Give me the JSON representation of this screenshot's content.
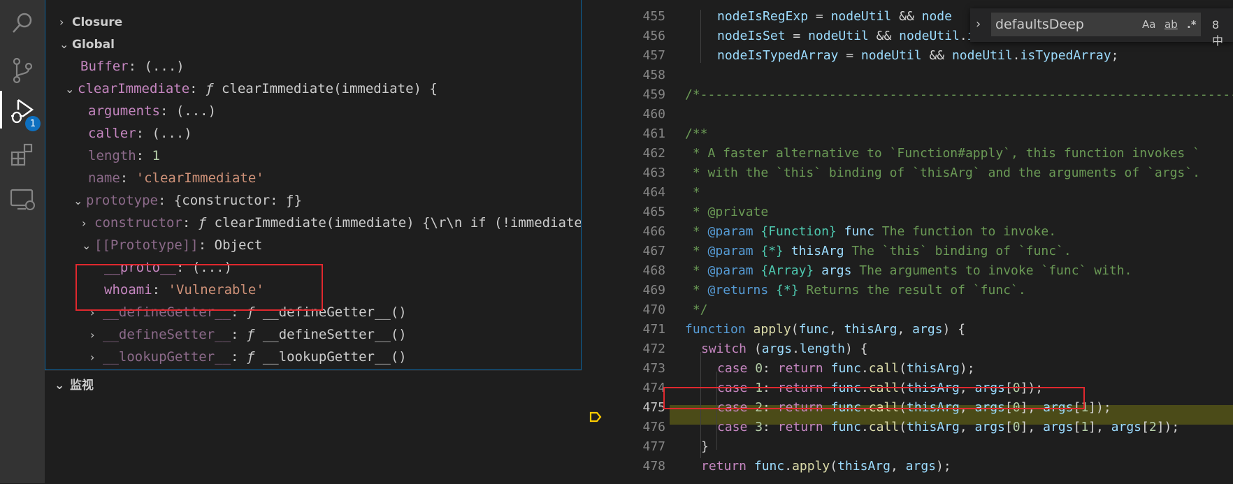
{
  "activity": {
    "items": [
      {
        "name": "search-icon"
      },
      {
        "name": "source-control-icon"
      },
      {
        "name": "run-debug-icon",
        "badge": "1"
      },
      {
        "name": "extensions-icon"
      },
      {
        "name": "remote-explorer-icon"
      }
    ]
  },
  "variables": {
    "scopes": {
      "closure": "Closure",
      "global": "Global"
    },
    "rows": {
      "buffer": {
        "key": "Buffer",
        "sep": ":",
        "val": "(...)"
      },
      "clearImmediate": {
        "key": "clearImmediate",
        "sep": ":",
        "f": "ƒ",
        "val": "clearImmediate(immediate) {"
      },
      "arguments": {
        "key": "arguments",
        "sep": ":",
        "val": "(...)"
      },
      "caller": {
        "key": "caller",
        "sep": ":",
        "val": "(...)"
      },
      "length": {
        "key": "length",
        "sep": ":",
        "val": "1"
      },
      "name": {
        "key": "name",
        "sep": ":",
        "val": "'clearImmediate'"
      },
      "prototype": {
        "key": "prototype",
        "sep": ":",
        "val": "{constructor: ƒ}"
      },
      "constructor": {
        "key": "constructor",
        "sep": ":",
        "f": "ƒ",
        "val": "clearImmediate(immediate) {\\r\\n  if (!immediate…"
      },
      "protoSlot": {
        "key": "[[Prototype]]",
        "sep": ":",
        "val": "Object"
      },
      "proto": {
        "key": "__proto__",
        "sep": ":",
        "val": "(...)"
      },
      "whoami": {
        "key": "whoami",
        "sep": ":",
        "val": "'Vulnerable'"
      },
      "defineGetter": {
        "key": "__defineGetter__",
        "sep": ":",
        "f": "ƒ",
        "val": "__defineGetter__()"
      },
      "defineSetter": {
        "key": "__defineSetter__",
        "sep": ":",
        "f": "ƒ",
        "val": "__defineSetter__()"
      },
      "lookupGetter": {
        "key": "__lookupGetter__",
        "sep": ":",
        "f": "ƒ",
        "val": "__lookupGetter__()"
      }
    }
  },
  "watch": {
    "title": "监视"
  },
  "find": {
    "value": "defaultsDeep",
    "opt_case": "Aa",
    "opt_word": "ab",
    "opt_regex": ".*",
    "count": "8 中"
  },
  "editor": {
    "line_numbers": [
      "455",
      "456",
      "457",
      "458",
      "459",
      "460",
      "461",
      "462",
      "463",
      "464",
      "465",
      "466",
      "467",
      "468",
      "469",
      "470",
      "471",
      "472",
      "473",
      "474",
      "475",
      "476",
      "477",
      "478"
    ],
    "current_line": "475",
    "code": {
      "l455": {
        "a": "nodeIsRegExp",
        "b": " = ",
        "c": "nodeUtil",
        "d": " && ",
        "e": "node"
      },
      "l456": {
        "a": "nodeIsSet",
        "b": " = ",
        "c": "nodeUtil",
        "d": " && ",
        "e": "nodeUtil",
        "f": ".",
        "g": "isSet",
        "h": ";"
      },
      "l457": {
        "a": "nodeIsTypedArray",
        "b": " = ",
        "c": "nodeUtil",
        "d": " && ",
        "e": "nodeUtil",
        "f": ".",
        "g": "isTypedArray",
        "h": ";"
      },
      "l459": "/*------------------------------------------------------------------------",
      "l461": "/**",
      "l462": " * A faster alternative to `Function#apply`, this function invokes `",
      "l463": " * with the `this` binding of `thisArg` and the arguments of `args`.",
      "l464": " *",
      "l465": " * @private",
      "l466": {
        "a": " * ",
        "b": "@param",
        "c": " {Function} ",
        "d": "func",
        "e": " The function to invoke."
      },
      "l467": {
        "a": " * ",
        "b": "@param",
        "c": " {*} ",
        "d": "thisArg",
        "e": " The `this` binding of `func`."
      },
      "l468": {
        "a": " * ",
        "b": "@param",
        "c": " {Array} ",
        "d": "args",
        "e": " The arguments to invoke `func` with."
      },
      "l469": {
        "a": " * ",
        "b": "@returns",
        "c": " {*}",
        "e": " Returns the result of `func`."
      },
      "l470": " */",
      "l471": {
        "kw": "function",
        "fn": "apply",
        "p1": "(",
        "a1": "func",
        "p2": ", ",
        "a2": "thisArg",
        "p3": ", ",
        "a3": "args",
        "p4": ") {"
      },
      "l472": {
        "kw": "switch",
        "p1": " (",
        "a1": "args",
        "p2": ".",
        "a2": "length",
        "p3": ") {"
      },
      "l473": {
        "kw": "case",
        "num": " 0",
        "p1": ": ",
        "kw2": "return",
        "a1": " func",
        "p2": ".",
        "fn": "call",
        "p3": "(",
        "a2": "thisArg",
        "p4": ");"
      },
      "l474": {
        "kw": "case",
        "num": " 1",
        "p1": ": ",
        "kw2": "return",
        "a1": " func",
        "p2": ".",
        "fn": "call",
        "p3": "(",
        "a2": "thisArg",
        "p4": ", ",
        "a3": "args",
        "p5": "[",
        "n1": "0",
        "p6": "]);"
      },
      "l475": {
        "kw": "case",
        "num": " 2",
        "p1": ": ",
        "kw2": "return",
        "a1": " func",
        "p2": ".",
        "fn": "call",
        "p3": "(",
        "a2": "thisArg",
        "p4": ", ",
        "a3": "args",
        "p5": "[",
        "n1": "0",
        "p6": "], ",
        "a4": "args",
        "p7": "[",
        "n2": "1",
        "p8": "]);"
      },
      "l476": {
        "kw": "case",
        "num": " 3",
        "p1": ": ",
        "kw2": "return",
        "a1": " func",
        "p2": ".",
        "fn": "call",
        "p3": "(",
        "a2": "thisArg",
        "p4": ", ",
        "a3": "args",
        "p5": "[",
        "n1": "0",
        "p6": "], ",
        "a4": "args",
        "p7": "[",
        "n2": "1",
        "p8": "], ",
        "a5": "args",
        "p9": "[",
        "n3": "2",
        "p10": "]);"
      },
      "l477": "}",
      "l478": {
        "kw": "return",
        "a1": " func",
        "p1": ".",
        "fn": "apply",
        "p2": "(",
        "a2": "thisArg",
        "p3": ", ",
        "a3": "args",
        "p4": ");"
      }
    }
  }
}
